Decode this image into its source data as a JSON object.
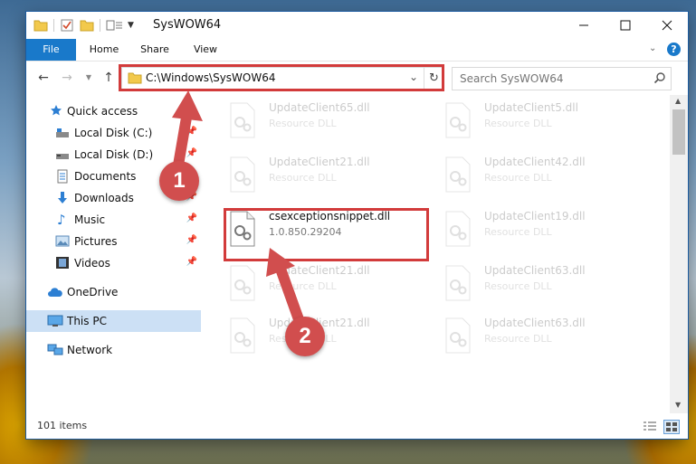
{
  "window": {
    "title": "SysWOW64"
  },
  "ribbon": {
    "tabs": [
      "File",
      "Home",
      "Share",
      "View"
    ]
  },
  "address": {
    "path": "C:\\Windows\\SysWOW64"
  },
  "search": {
    "placeholder": "Search SysWOW64"
  },
  "nav": {
    "items": [
      {
        "label": "Quick access",
        "icon": "star-icon"
      },
      {
        "label": "Local Disk (C:)",
        "icon": "drive-icon",
        "pinned": true
      },
      {
        "label": "Local Disk (D:)",
        "icon": "drive-icon",
        "pinned": true
      },
      {
        "label": "Documents",
        "icon": "documents-icon",
        "pinned": true
      },
      {
        "label": "Downloads",
        "icon": "download-icon",
        "pinned": true
      },
      {
        "label": "Music",
        "icon": "music-icon",
        "pinned": true
      },
      {
        "label": "Pictures",
        "icon": "pictures-icon",
        "pinned": true
      },
      {
        "label": "Videos",
        "icon": "videos-icon",
        "pinned": true
      },
      {
        "label": "OneDrive",
        "icon": "cloud-icon"
      },
      {
        "label": "This PC",
        "icon": "computer-icon",
        "selected": true
      },
      {
        "label": "Network",
        "icon": "network-icon"
      }
    ]
  },
  "files": [
    {
      "name": "UpdateClient65.dll",
      "desc": "Resource DLL",
      "faded": true
    },
    {
      "name": "UpdateClient5.dll",
      "desc": "Resource DLL",
      "faded": true
    },
    {
      "name": "UpdateClient21.dll",
      "desc": "Resource DLL",
      "faded": true
    },
    {
      "name": "UpdateClient42.dll",
      "desc": "Resource DLL",
      "faded": true
    },
    {
      "name": "csexceptionsnippet.dll",
      "desc": "1.0.850.29204",
      "faded": false,
      "highlighted": true
    },
    {
      "name": "UpdateClient19.dll",
      "desc": "Resource DLL",
      "faded": true
    },
    {
      "name": "UpdateClient21.dll",
      "desc": "Resource DLL",
      "faded": true
    },
    {
      "name": "UpdateClient63.dll",
      "desc": "Resource DLL",
      "faded": true
    },
    {
      "name": "UpdateClient21.dll",
      "desc": "Resource DLL",
      "faded": true
    },
    {
      "name": "UpdateClient63.dll",
      "desc": "Resource DLL",
      "faded": true
    }
  ],
  "status": {
    "items_count": "101 items"
  },
  "callouts": [
    "1",
    "2"
  ],
  "colors": {
    "accent": "#1979ca",
    "highlight": "#d23b3b",
    "selected": "#cce0f5"
  }
}
